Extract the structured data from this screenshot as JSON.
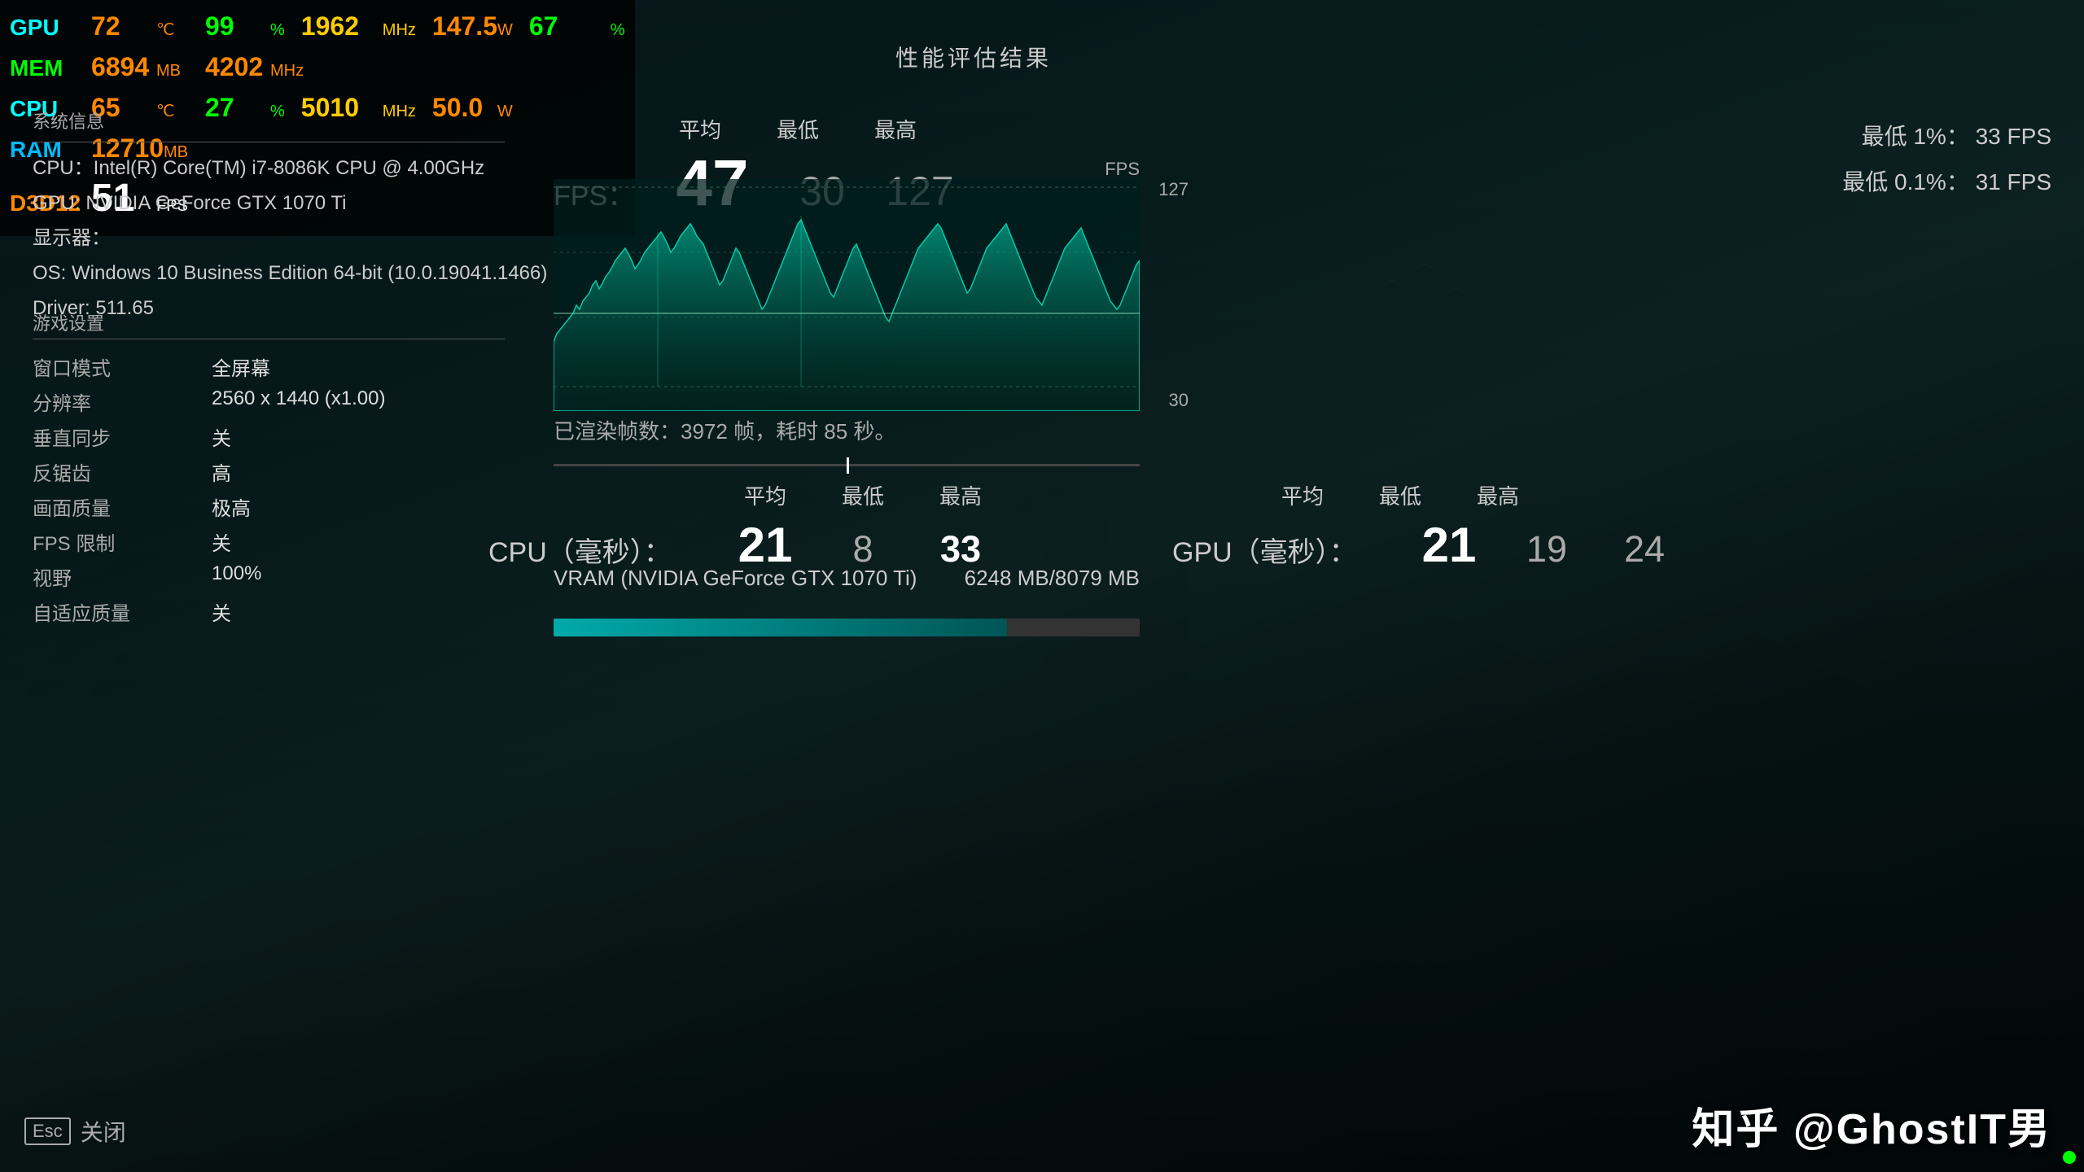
{
  "background": {
    "colors": {
      "bg_start": "#0a1a1f",
      "bg_mid": "#0d2a2a",
      "bg_end": "#060e10"
    }
  },
  "hud": {
    "gpu_label": "GPU",
    "gpu_temp": "72",
    "gpu_temp_unit": "℃",
    "gpu_usage": "99",
    "gpu_usage_unit": "%",
    "gpu_clock": "1962",
    "gpu_clock_unit": "MHz",
    "gpu_power": "147.5",
    "gpu_power_unit": "W",
    "gpu_vram": "67",
    "gpu_vram_unit": "%",
    "mem_label": "MEM",
    "mem_val": "6894",
    "mem_unit": "MB",
    "mem_clock": "4202",
    "mem_clock_unit": "MHz",
    "cpu_label": "CPU",
    "cpu_temp": "65",
    "cpu_temp_unit": "℃",
    "cpu_usage": "27",
    "cpu_usage_unit": "%",
    "cpu_clock": "5010",
    "cpu_clock_unit": "MHz",
    "cpu_power": "50.0",
    "cpu_power_unit": "W",
    "ram_label": "RAM",
    "ram_val": "12710",
    "ram_unit": "MB",
    "d3d_label": "D3D12",
    "d3d_fps": "51",
    "d3d_fps_unit": "FPS"
  },
  "sys_info": {
    "title": "系统信息",
    "cpu": "CPU：Intel(R) Core(TM) i7-8086K CPU @ 4.00GHz",
    "gpu": "GPU: NVIDIA GeForce GTX 1070 Ti",
    "display": "显示器：",
    "os": "OS: Windows 10 Business Edition 64-bit (10.0.19041.1466)",
    "driver": "Driver: 511.65"
  },
  "game_settings": {
    "title": "游戏设置",
    "window_mode_key": "窗口模式",
    "window_mode_val": "全屏幕",
    "resolution_key": "分辨率",
    "resolution_val": "2560 x 1440 (x1.00)",
    "vsync_key": "垂直同步",
    "vsync_val": "关",
    "aa_key": "反锯齿",
    "aa_val": "高",
    "quality_key": "画面质量",
    "quality_val": "极高",
    "fps_limit_key": "FPS 限制",
    "fps_limit_val": "关",
    "fov_key": "视野",
    "fov_val": "100%",
    "adaptive_key": "自适应质量",
    "adaptive_val": "关"
  },
  "perf": {
    "title": "性能评估结果",
    "fps_label": "FPS：",
    "avg_label": "平均",
    "min_label": "最低",
    "max_label": "最高",
    "fps_avg": "47",
    "fps_min": "30",
    "fps_max": "127",
    "pct1_label": "最低 1%：",
    "pct1_val": "33 FPS",
    "pct01_label": "最低 0.1%：",
    "pct01_val": "31 FPS",
    "chart_ymax": "127",
    "chart_ymin": "30",
    "chart_y_label": "FPS",
    "render_info": "已渲染帧数：3972 帧，耗时 85 秒。",
    "cpu_ms_label": "CPU（毫秒）：",
    "cpu_avg": "21",
    "cpu_min": "8",
    "cpu_max": "33",
    "gpu_ms_label": "GPU（毫秒）：",
    "gpu_avg": "21",
    "gpu_min": "19",
    "gpu_max": "24",
    "vram_label": "VRAM (NVIDIA GeForce GTX 1070 Ti)",
    "vram_used": "6248",
    "vram_total": "8079",
    "vram_unit": "MB"
  },
  "footer": {
    "esc_label": "Esc",
    "close_label": "关闭"
  },
  "watermark": "知乎 @GhostIT男"
}
